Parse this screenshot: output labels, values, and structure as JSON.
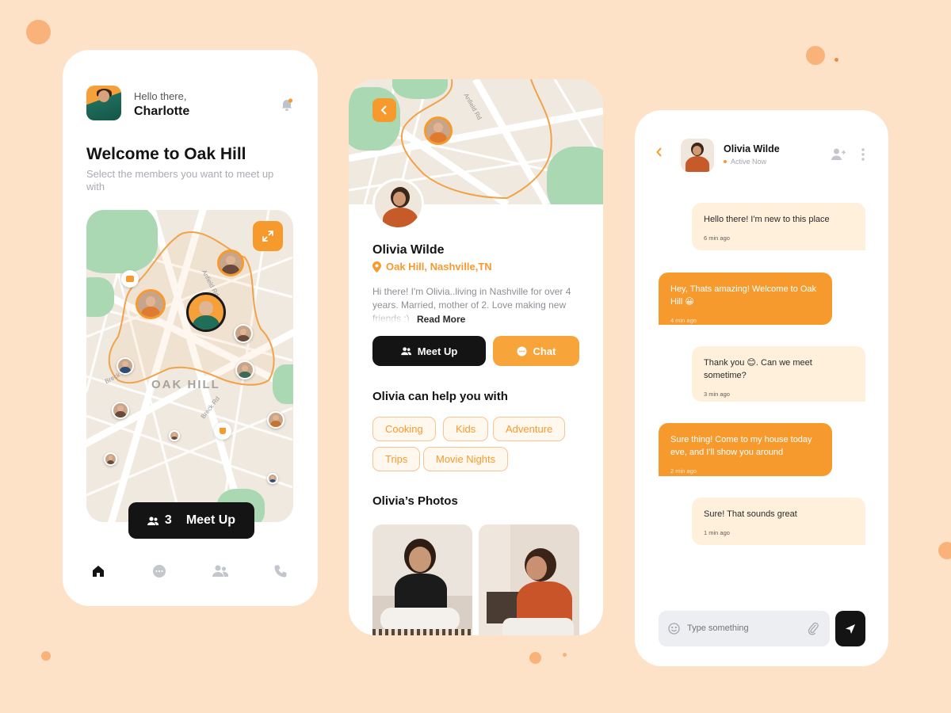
{
  "home": {
    "greeting": "Hello there,",
    "user_name": "Charlotte",
    "title": "Welcome to Oak Hill",
    "subtitle": "Select the members you want to meet up with",
    "map": {
      "area_label": "OAK HILL",
      "streets": [
        "Breck Rd",
        "Anfield Rd",
        "Breck Rd"
      ]
    },
    "meetup_count": "3",
    "meetup_label": "Meet Up",
    "nav": [
      "home-icon",
      "chat-icon",
      "people-icon",
      "phone-icon"
    ],
    "colors": {
      "accent": "#f79a2e",
      "dark": "#141414"
    }
  },
  "profile": {
    "name": "Olivia Wilde",
    "location": "Oak Hill, Nashville,TN",
    "bio": "Hi there! I'm Olivia..living in Nashville for over 4 years. Married, mother of 2. Love making new friends :)",
    "read_more": "Read More",
    "meetup_label": "Meet Up",
    "chat_label": "Chat",
    "help_heading": "Olivia can help you with",
    "tags": [
      "Cooking",
      "Kids",
      "Adventure",
      "Trips",
      "Movie Nights"
    ],
    "photos_heading": "Olivia’s Photos",
    "map_street": "Anfield Rd"
  },
  "chat": {
    "contact_name": "Olivia Wilde",
    "status": "Active Now",
    "messages": [
      {
        "dir": "in",
        "text": "Hello there! I'm new to this place",
        "time": "6 min ago"
      },
      {
        "dir": "out",
        "text": "Hey, Thats amazing! Welcome to Oak Hill 😀",
        "time": "4 min ago"
      },
      {
        "dir": "in",
        "text": "Thank you 😊. Can we meet sometime?",
        "time": "3 min ago"
      },
      {
        "dir": "out",
        "text": "Sure thing! Come to my house today eve, and I'll show you around",
        "time": "2 min ago"
      },
      {
        "dir": "in",
        "text": "Sure! That sounds great",
        "time": "1 min ago"
      }
    ],
    "input_placeholder": "Type something"
  }
}
